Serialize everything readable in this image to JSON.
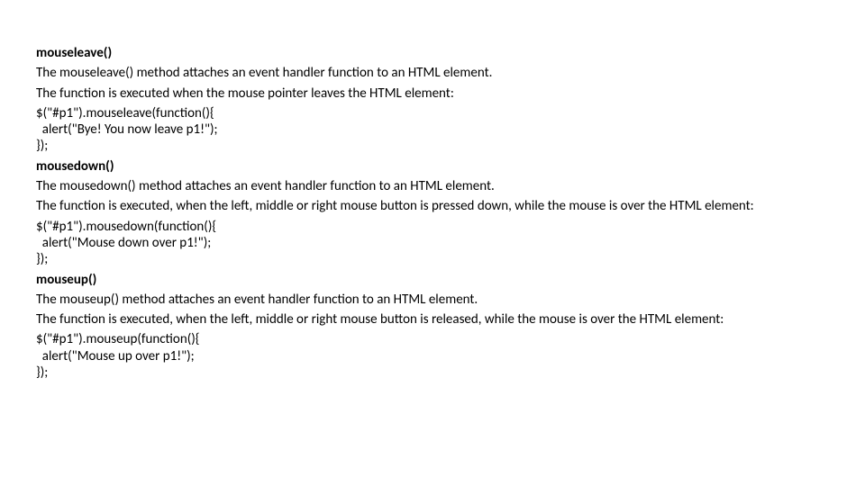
{
  "sections": [
    {
      "heading": "mouseleave()",
      "desc1": "The mouseleave() method attaches an event handler function to an HTML element.",
      "desc2": "The function is executed when the mouse pointer leaves the HTML element:",
      "code": "$(\"#p1\").mouseleave(function(){\n  alert(\"Bye! You now leave p1!\");\n});"
    },
    {
      "heading": "mousedown()",
      "desc1": "The mousedown() method attaches an event handler function to an HTML element.",
      "desc2": "The function is executed, when the left, middle or right mouse button is pressed down, while the mouse is over the HTML element:",
      "code": "$(\"#p1\").mousedown(function(){\n  alert(\"Mouse down over p1!\");\n});"
    },
    {
      "heading": "mouseup()",
      "desc1": "The mouseup() method attaches an event handler function to an HTML element.",
      "desc2": "The function is executed, when the left, middle or right mouse button is released, while the mouse is over the HTML element:",
      "code": "$(\"#p1\").mouseup(function(){\n  alert(\"Mouse up over p1!\");\n});"
    }
  ]
}
